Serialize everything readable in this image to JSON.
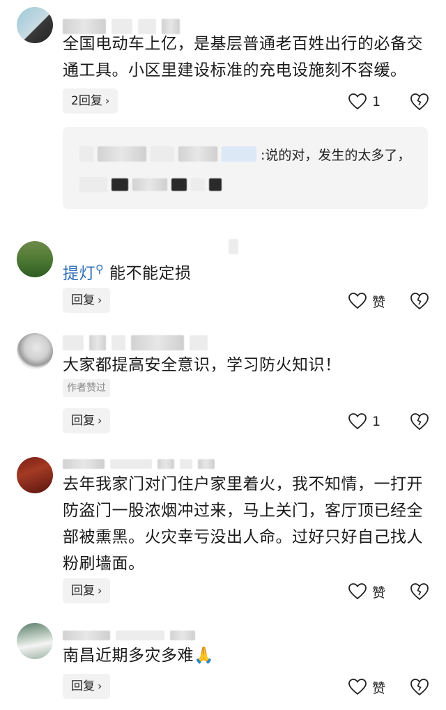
{
  "comments": [
    {
      "text": "全国电动车上亿，是基层普通老百姓出行的必备交通工具。小区里建设标准的充电设施刻不容缓。",
      "reply_label": "2回复",
      "like_count": "1",
      "sub_reply": {
        "text": ":说的对，发生的太多了，"
      }
    },
    {
      "mention": "提灯",
      "text": "能不能定损",
      "reply_label": "回复",
      "like_label": "赞"
    },
    {
      "text": "大家都提高安全意识，学习防火知识！",
      "tag": "作者赞过",
      "reply_label": "回复",
      "like_count": "1"
    },
    {
      "text": "去年我家门对门住户家里着火，我不知情，一打开防盗门一股浓烟冲过来，马上关门，客厅顶已经全部被熏黑。火灾幸亏没出人命。过好只好自己找人粉刷墙面。",
      "reply_label": "回复",
      "like_label": "赞"
    },
    {
      "text": "南昌近期多灾多难🙏",
      "reply_label": "回复",
      "like_label": "赞"
    }
  ],
  "icons": {
    "like": "heart-outline-icon",
    "dislike": "broken-heart-icon",
    "reply_chevron": "chevron-right-icon",
    "mention_search": "search-icon"
  },
  "colors": {
    "mention": "#2f6fb6",
    "button_bg": "#f2f2f2",
    "subbox_bg": "#f4f4f5"
  }
}
